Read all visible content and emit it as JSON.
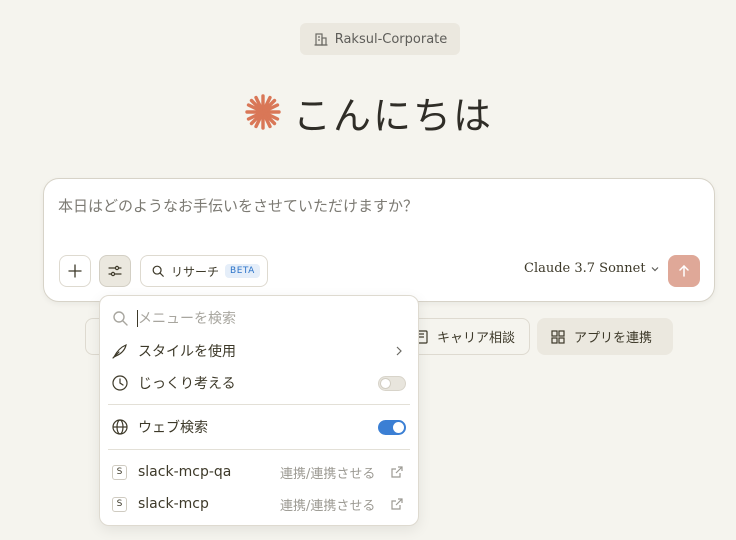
{
  "org": {
    "name": "Raksul-Corporate",
    "icon": "building-icon"
  },
  "greeting": {
    "text": "こんにちは",
    "icon": "spark-logo-icon",
    "icon_color": "#d97757"
  },
  "composer": {
    "placeholder": "本日はどのようなお手伝いをさせていただけますか？",
    "plus_icon": "plus-icon",
    "tools_icon": "sliders-icon",
    "research": {
      "label": "リサーチ",
      "badge": "BETA",
      "icon": "search-magnifier-icon"
    },
    "model": "Claude 3.7 Sonnet",
    "send_icon": "arrow-up-icon",
    "send_color": "#dfa898"
  },
  "chips": [
    {
      "label": "キャリア相談",
      "icon": "id-card-icon"
    },
    {
      "label": "アプリを連携",
      "icon": "grid-icon"
    }
  ],
  "menu": {
    "search_placeholder": "メニューを検索",
    "items": [
      {
        "label": "スタイルを使用",
        "icon": "feather-pen-icon",
        "control": "chevron"
      },
      {
        "label": "じっくり考える",
        "icon": "clock-icon",
        "control": "toggle",
        "on": false
      },
      {
        "label": "ウェブ検索",
        "icon": "globe-icon",
        "control": "toggle",
        "on": true
      }
    ],
    "integrations": [
      {
        "badge": "S",
        "label": "slack-mcp-qa",
        "action": "連携/連携させる"
      },
      {
        "badge": "S",
        "label": "slack-mcp",
        "action": "連携/連携させる"
      }
    ]
  },
  "colors": {
    "background": "#f5f4ee",
    "toggle_on": "#3b7fd4",
    "beta_text": "#2c74c9"
  }
}
